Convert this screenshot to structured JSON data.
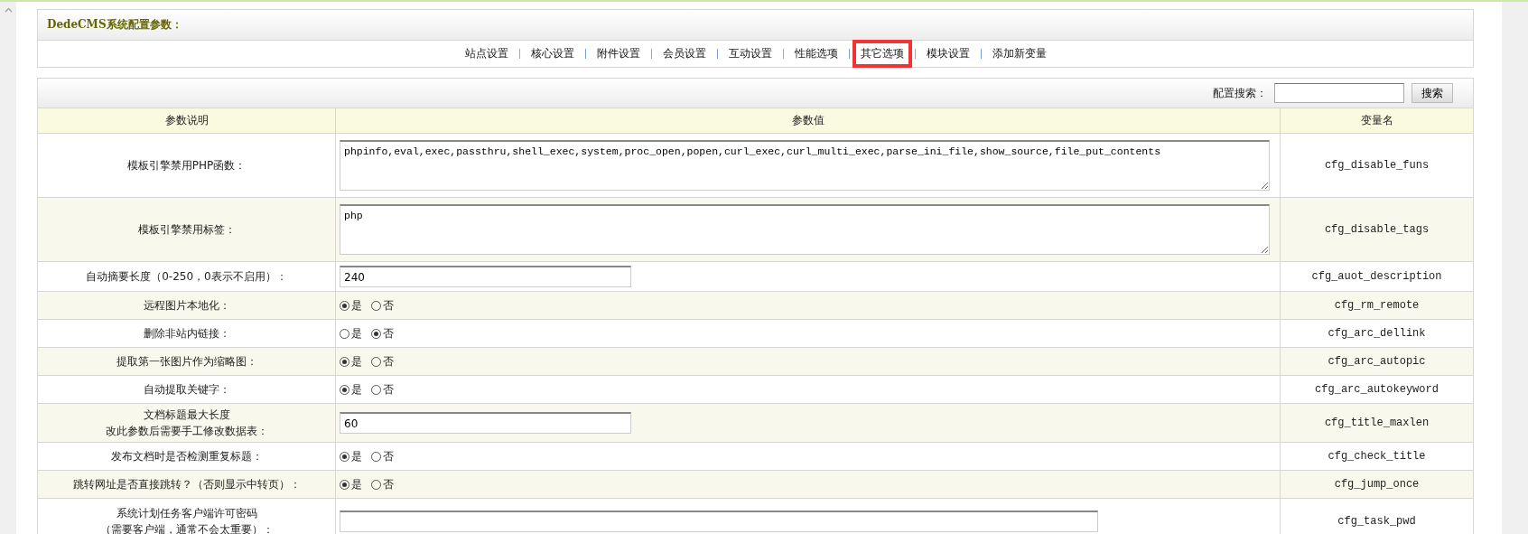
{
  "title": "DedeCMS系统配置参数：",
  "nav": [
    {
      "label": "站点设置",
      "highlighted": false
    },
    {
      "label": "核心设置",
      "highlighted": false
    },
    {
      "label": "附件设置",
      "highlighted": false
    },
    {
      "label": "会员设置",
      "highlighted": false
    },
    {
      "label": "互动设置",
      "highlighted": false
    },
    {
      "label": "性能选项",
      "highlighted": false
    },
    {
      "label": "其它选项",
      "highlighted": true
    },
    {
      "label": "模块设置",
      "highlighted": false
    },
    {
      "label": "添加新变量",
      "highlighted": false
    }
  ],
  "search": {
    "label": "配置搜索：",
    "button": "搜索"
  },
  "table": {
    "columns": [
      "参数说明",
      "参数值",
      "变量名"
    ],
    "rows": [
      {
        "kind": "textarea",
        "label": "模板引擎禁用PHP函数：",
        "value": "phpinfo,eval,exec,passthru,shell_exec,system,proc_open,popen,curl_exec,curl_multi_exec,parse_ini_file,show_source,file_put_contents",
        "variable": "cfg_disable_funs"
      },
      {
        "kind": "textarea",
        "label": "模板引擎禁用标签：",
        "value": "php",
        "variable": "cfg_disable_tags"
      },
      {
        "kind": "text",
        "label": "自动摘要长度（0-250，0表示不启用）：",
        "value": "240",
        "variable": "cfg_auot_description"
      },
      {
        "kind": "radio",
        "label": "远程图片本地化：",
        "options": [
          {
            "label": "是",
            "selected": true
          },
          {
            "label": "否",
            "selected": false
          }
        ],
        "variable": "cfg_rm_remote"
      },
      {
        "kind": "radio",
        "label": "删除非站内链接：",
        "options": [
          {
            "label": "是",
            "selected": false
          },
          {
            "label": "否",
            "selected": true
          }
        ],
        "variable": "cfg_arc_dellink"
      },
      {
        "kind": "radio",
        "label": "提取第一张图片作为缩略图：",
        "options": [
          {
            "label": "是",
            "selected": true
          },
          {
            "label": "否",
            "selected": false
          }
        ],
        "variable": "cfg_arc_autopic"
      },
      {
        "kind": "radio",
        "label": "自动提取关键字：",
        "options": [
          {
            "label": "是",
            "selected": true
          },
          {
            "label": "否",
            "selected": false
          }
        ],
        "variable": "cfg_arc_autokeyword"
      },
      {
        "kind": "text",
        "label": [
          "文档标题最大长度",
          "改此参数后需要手工修改数据表："
        ],
        "value": "60",
        "variable": "cfg_title_maxlen"
      },
      {
        "kind": "radio",
        "label": "发布文档时是否检测重复标题：",
        "options": [
          {
            "label": "是",
            "selected": true
          },
          {
            "label": "否",
            "selected": false
          }
        ],
        "variable": "cfg_check_title"
      },
      {
        "kind": "radio",
        "label": "跳转网址是否直接跳转？（否则显示中转页）：",
        "options": [
          {
            "label": "是",
            "selected": true
          },
          {
            "label": "否",
            "selected": false
          }
        ],
        "variable": "cfg_jump_once"
      },
      {
        "kind": "wide",
        "label": [
          "系统计划任务客户端许可密码",
          "（需要客户端，通常不会太重要）："
        ],
        "value": "",
        "variable": "cfg_task_pwd"
      }
    ]
  }
}
